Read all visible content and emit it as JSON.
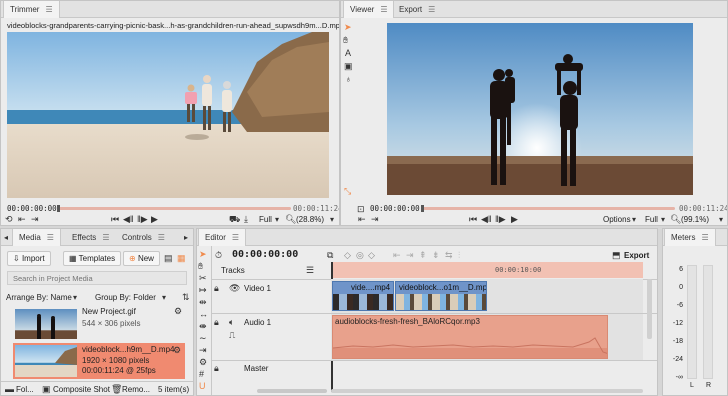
{
  "trimmer": {
    "tab": "Trimmer",
    "filename": "videoblocks-grandparents-carrying-picnic-bask...h-as-grandchildren-run-ahead_supwsdh9m...D.mp4",
    "time_current": "00:00:00:00",
    "time_end": "00:00:11:24",
    "zoom_mode": "Full",
    "zoom_pct": "(28.8%)"
  },
  "viewer": {
    "tab": "Viewer",
    "tab2": "Export",
    "time_current": "00:00:00:00",
    "time_end": "00:00:11:24",
    "options": "Options",
    "zoom_mode": "Full",
    "zoom_pct": "(99.1%)"
  },
  "media": {
    "tabs": [
      "Media",
      "Effects",
      "Controls"
    ],
    "import": "Import",
    "templates": "Templates",
    "new": "New",
    "search_placeholder": "Search in Project Media",
    "arrange": "Arrange By: Name",
    "group": "Group By: Folder",
    "items": [
      {
        "name": "New Project.gif",
        "meta1": "544 × 306 pixels",
        "meta2": ""
      },
      {
        "name": "videoblock...h9m__D.mp4",
        "meta1": "1920 × 1080 pixels",
        "meta2": "00:00:11:24 @ 25fps"
      }
    ],
    "footer": {
      "folder": "Fol...",
      "composite": "Composite Shot",
      "remove": "Remo...",
      "count": "5 item(s)"
    }
  },
  "editor": {
    "tab": "Editor",
    "timecode": "00:00:00:00",
    "export": "Export",
    "tracks_label": "Tracks",
    "ruler_time": "00:00:10:00",
    "video_track": "Video 1",
    "audio_track": "Audio 1",
    "master": "Master",
    "clip1": "vide....mp4",
    "clip2": "videoblock...o1m__D.mp4",
    "audio_clip": "audioblocks-fresh-fresh_BAloRCqor.mp3"
  },
  "meters": {
    "tab": "Meters",
    "scale": [
      "6",
      "0",
      "-6",
      "-12",
      "-18",
      "-24",
      "-∞"
    ],
    "channels": [
      "L",
      "R"
    ]
  },
  "colors": {
    "accent": "#f08a4b",
    "playhead": "#e6b3a7",
    "clip_video": "#6f94c9",
    "clip_audio": "#e8a18c"
  }
}
